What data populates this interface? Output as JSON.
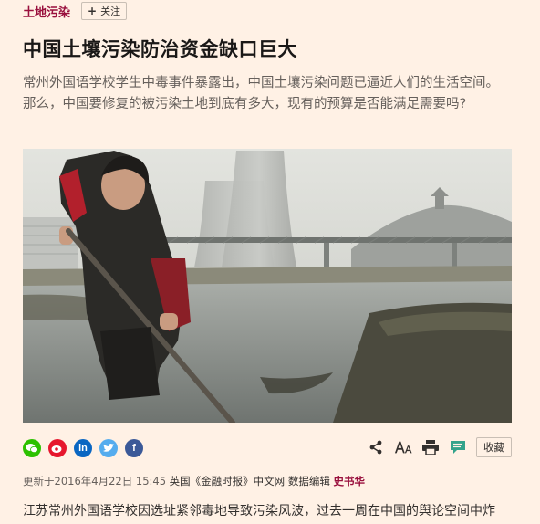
{
  "topic": {
    "label": "土地污染",
    "follow_label": "关注",
    "follow_icon": "plus-icon"
  },
  "article": {
    "headline": "中国土壤污染防治资金缺口巨大",
    "standfirst": "常州外国语学校学生中毒事件暴露出，中国土壤污染问题已逼近人们的生活空间。那么，中国要修复的被污染土地到底有多大，现有的预算是否能满足需要吗?",
    "body_first_line": "江苏常州外国语学校因选址紧邻毒地导致污染风波，过去一周在中国的舆论空间中炸"
  },
  "share": {
    "icons": [
      "wechat-icon",
      "weibo-icon",
      "linkedin-icon",
      "twitter-icon",
      "facebook-icon"
    ],
    "colors": {
      "wechat": "#2dc100",
      "weibo": "#e6162d",
      "linkedin": "#0a66c2",
      "twitter": "#55acee",
      "facebook": "#3b5998"
    },
    "favorite_label": "收藏"
  },
  "byline": {
    "updated": "更新于2016年4月22日 15:45",
    "source": "英国《金融时报》中文网",
    "role": "数据编辑",
    "author": "史书华"
  },
  "colors": {
    "background": "#fff1e5",
    "accent": "#990f3d",
    "comment_icon": "#33a38b"
  }
}
